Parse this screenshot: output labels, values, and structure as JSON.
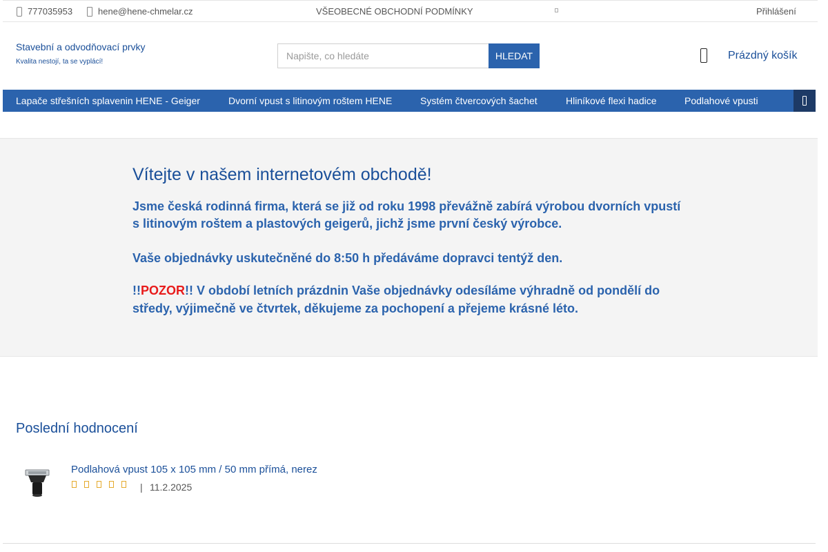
{
  "topbar": {
    "phone": "777035953",
    "email": "hene@hene-chmelar.cz",
    "terms_link": "VŠEOBECNÉ OBCHODNÍ PODMÍNKY",
    "login": "Přihlášení"
  },
  "header": {
    "brand_title": "Stavební a odvodňovací prvky",
    "brand_subtitle": "Kvalita nestojí, ta se vyplácí!",
    "search_placeholder": "Napište, co hledáte",
    "search_button": "HLEDAT",
    "cart_label": "Prázdný košík"
  },
  "nav": {
    "items": [
      {
        "label": "Lapače střešních splavenin HENE - Geiger"
      },
      {
        "label": "Dvorní vpust s litinovým roštem HENE"
      },
      {
        "label": "Systém čtvercových šachet"
      },
      {
        "label": "Hliníkové flexi hadice"
      },
      {
        "label": "Podlahové vpusti"
      }
    ]
  },
  "welcome": {
    "heading": "Vítejte v našem internetovém obchodě!",
    "paragraph1": "Jsme česká rodinná firma, která se již od roku 1998 převážně zabírá výrobou dvorních vpustí s litinovým roštem a plastových geigerů, jichž jsme první český výrobce.",
    "paragraph2": "Vaše objednávky uskutečněné do 8:50 h předáváme dopravci tentýž den.",
    "notice_prefix": "!!",
    "notice_highlight": "POZOR",
    "notice_text": "!! V období letních prázdnin Vaše objednávky odesíláme výhradně od pondělí do středy, výjimečně ve čtvrtek, děkujeme za pochopení a přejeme krásné léto."
  },
  "reviews": {
    "title": "Poslední hodnocení",
    "items": [
      {
        "product": "Podlahová vpust 105 x 105 mm / 50 mm přímá, nerez",
        "stars": 5,
        "separator": "|",
        "date": "11.2.2025"
      }
    ]
  },
  "colors": {
    "primary": "#2b63ad",
    "dark_blue": "#1a4f99",
    "nav_more": "#1d3a66",
    "alert_red": "#e81b1b",
    "star": "#e5a92a"
  }
}
